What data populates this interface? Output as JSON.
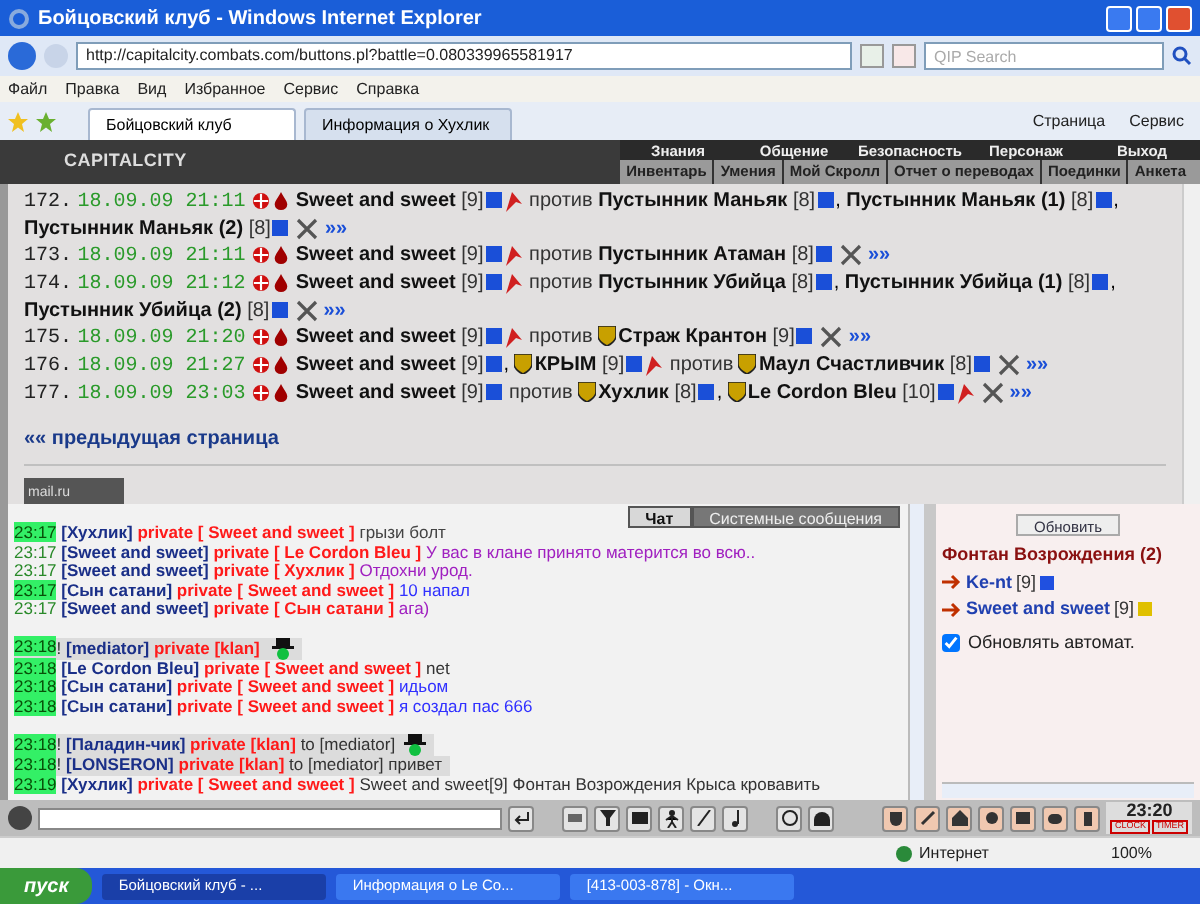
{
  "window": {
    "title": "Бойцовский клуб - Windows Internet Explorer"
  },
  "address_bar": {
    "url": "http://capitalcity.combats.com/buttons.pl?battle=0.080339965581917",
    "search_placeholder": "QIP Search"
  },
  "menu": [
    "Файл",
    "Правка",
    "Вид",
    "Избранное",
    "Сервис",
    "Справка"
  ],
  "browser_tabs": [
    {
      "label": "Бойцовский клуб",
      "selected": true
    },
    {
      "label": "Информация о Хухлик",
      "selected": false
    }
  ],
  "command_bar": [
    "Страница",
    "Сервис"
  ],
  "game_header": {
    "logo": "CAPITALCITY",
    "nav": [
      "Знания",
      "Общение",
      "Безопасность",
      "Персонаж",
      "Выход"
    ],
    "subnav": [
      "Инвентарь",
      "Умения",
      "Мой Скролл",
      "Отчет о переводах",
      "Поединки",
      "Анкета"
    ]
  },
  "battle_log": {
    "separator": ",",
    "entries": [
      {
        "num": "172.",
        "time": "18.09.09 21:11",
        "vs": "против",
        "link": "»»",
        "sides": [
          [
            {
              "name": "Sweet and sweet",
              "level": "[9]",
              "flag": true,
              "emblem": false
            }
          ],
          [
            {
              "name": "Пустынник Маньяк",
              "level": "[8]",
              "flag": false,
              "emblem": false
            },
            {
              "name": "Пустынник Маньяк (1)",
              "level": "[8]",
              "flag": false,
              "emblem": false
            },
            {
              "name": "Пустынник Маньяк (2)",
              "level": "[8]",
              "flag": false,
              "emblem": false
            }
          ]
        ]
      },
      {
        "num": "173.",
        "time": "18.09.09 21:11",
        "vs": "против",
        "link": "»»",
        "sides": [
          [
            {
              "name": "Sweet and sweet",
              "level": "[9]",
              "flag": true,
              "emblem": false
            }
          ],
          [
            {
              "name": "Пустынник Атаман",
              "level": "[8]",
              "flag": false,
              "emblem": false
            }
          ]
        ]
      },
      {
        "num": "174.",
        "time": "18.09.09 21:12",
        "vs": "против",
        "link": "»»",
        "sides": [
          [
            {
              "name": "Sweet and sweet",
              "level": "[9]",
              "flag": true,
              "emblem": false
            }
          ],
          [
            {
              "name": "Пустынник Убийца",
              "level": "[8]",
              "flag": false,
              "emblem": false
            },
            {
              "name": "Пустынник Убийца (1)",
              "level": "[8]",
              "flag": false,
              "emblem": false
            },
            {
              "name": "Пустынник Убийца (2)",
              "level": "[8]",
              "flag": false,
              "emblem": false
            }
          ]
        ]
      },
      {
        "num": "175.",
        "time": "18.09.09 21:20",
        "vs": "против",
        "link": "»»",
        "sides": [
          [
            {
              "name": "Sweet and sweet",
              "level": "[9]",
              "flag": true,
              "emblem": false
            }
          ],
          [
            {
              "name": "Страж Крантон",
              "level": "[9]",
              "flag": false,
              "emblem": true
            }
          ]
        ]
      },
      {
        "num": "176.",
        "time": "18.09.09 21:27",
        "vs": "против",
        "link": "»»",
        "sides": [
          [
            {
              "name": "Sweet and sweet",
              "level": "[9]",
              "flag": false,
              "emblem": false
            },
            {
              "name": "КРЫМ",
              "level": "[9]",
              "flag": true,
              "emblem": true
            }
          ],
          [
            {
              "name": "Маул Счастливчик",
              "level": "[8]",
              "flag": false,
              "emblem": true
            }
          ]
        ]
      },
      {
        "num": "177.",
        "time": "18.09.09 23:03",
        "vs": "против",
        "link": "»»",
        "sides": [
          [
            {
              "name": "Sweet and sweet",
              "level": "[9]",
              "flag": false,
              "emblem": false
            }
          ],
          [
            {
              "name": "Хухлик",
              "level": "[8]",
              "flag": false,
              "emblem": true
            },
            {
              "name": "Le Cordon Bleu",
              "level": "[10]",
              "flag": true,
              "emblem": true
            }
          ]
        ]
      }
    ],
    "previous_page": "«« предыдущая страница",
    "counter": "mail.ru"
  },
  "chat": {
    "tabs": [
      {
        "label": "Чат",
        "selected": true
      },
      {
        "label": "Системные сообщения",
        "selected": false
      }
    ],
    "messages": [
      {
        "time": "23:17",
        "highlight": true,
        "gap": false,
        "moderated": false,
        "hat": false,
        "sender": "[Хухлик]",
        "private": "private [ Sweet and sweet ]",
        "message": "грызи болт",
        "color": "#444444"
      },
      {
        "time": "23:17",
        "highlight": false,
        "gap": false,
        "moderated": false,
        "hat": false,
        "sender": "[Sweet and sweet]",
        "private": "private [ Le Cordon Bleu ]",
        "message": "У вас в клане принято матерится во всю..",
        "color": "#a020c0"
      },
      {
        "time": "23:17",
        "highlight": false,
        "gap": false,
        "moderated": false,
        "hat": false,
        "sender": "[Sweet and sweet]",
        "private": "private [ Хухлик ]",
        "message": "Отдохни урод.",
        "color": "#a020c0"
      },
      {
        "time": "23:17",
        "highlight": true,
        "gap": false,
        "moderated": false,
        "hat": false,
        "sender": "[Сын сатани]",
        "private": "private [ Sweet and sweet ]",
        "message": "10 напал",
        "color": "#3030ff"
      },
      {
        "time": "23:17",
        "highlight": false,
        "gap": false,
        "moderated": false,
        "hat": false,
        "sender": "[Sweet and sweet]",
        "private": "private [ Сын сатани ]",
        "message": "ага)",
        "color": "#a020c0"
      },
      {
        "time": "23:18",
        "highlight": true,
        "gap": true,
        "moderated": true,
        "hat": true,
        "mark": "!",
        "sender": "[mediator]",
        "private": "private [klan]"
      },
      {
        "time": "23:18",
        "highlight": true,
        "gap": false,
        "moderated": false,
        "hat": false,
        "sender": "[Le Cordon Bleu]",
        "private": "private [ Sweet and sweet ]",
        "message": "net",
        "color": "#333333"
      },
      {
        "time": "23:18",
        "highlight": true,
        "gap": false,
        "moderated": false,
        "hat": false,
        "sender": "[Сын сатани]",
        "private": "private [ Sweet and sweet ]",
        "message": "идьом",
        "color": "#3030ff"
      },
      {
        "time": "23:18",
        "highlight": true,
        "gap": false,
        "moderated": false,
        "hat": false,
        "sender": "[Сын сатани]",
        "private": "private [ Sweet and sweet ]",
        "message": "я создал пас 666",
        "color": "#3030ff"
      },
      {
        "time": "23:18",
        "highlight": true,
        "gap": true,
        "moderated": true,
        "hat": true,
        "mark": "!",
        "sender": "[Паладин-чик]",
        "private": "private [klan]",
        "message": "to [mediator]",
        "color": "#333333"
      },
      {
        "time": "23:18",
        "highlight": true,
        "gap": false,
        "moderated": true,
        "hat": false,
        "mark": "!",
        "sender": "[LONSERON]",
        "private": "private [klan]",
        "message": "to [mediator] привет",
        "color": "#333333"
      },
      {
        "time": "23:19",
        "highlight": true,
        "gap": false,
        "moderated": false,
        "hat": false,
        "sender": "[Хухлик]",
        "private": "private [ Sweet and sweet ]",
        "message": "Sweet and sweet[9] Фонтан Возрождения Крыса кровавить",
        "color": "#333333"
      }
    ]
  },
  "location_panel": {
    "refresh_button": "Обновить",
    "title": "Фонтан Возрождения (2)",
    "users": [
      {
        "name": "Ke-nt",
        "level": "[9]",
        "color": "#2050e0"
      },
      {
        "name": "Sweet and sweet",
        "level": "[9]",
        "color": "#e0c000"
      }
    ],
    "auto_refresh": {
      "label": "Обновлять автомат.",
      "checked": true
    }
  },
  "clock": {
    "time": "23:20",
    "labels": [
      "CLOCK",
      "TIMER"
    ]
  },
  "status_bar": {
    "zone": "Интернет",
    "zoom": "100%"
  },
  "taskbar": {
    "start": "пуск",
    "items": [
      "Бойцовский клуб - ...",
      "Информация о Le Co...",
      "[413-003-878] - Окн..."
    ]
  }
}
